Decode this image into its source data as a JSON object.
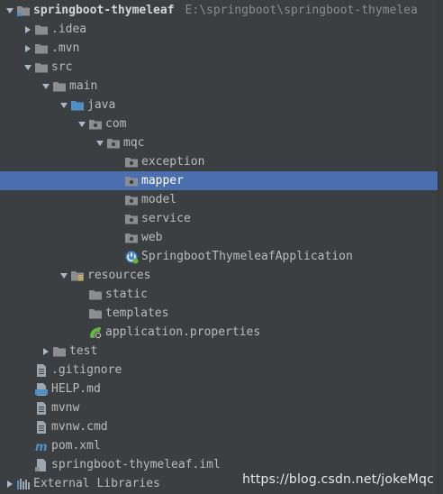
{
  "project": {
    "name": "springboot-thymeleaf",
    "path": "E:\\springboot\\springboot-thymelea"
  },
  "tree": [
    {
      "label": "springboot-thymeleaf",
      "icon": "project-folder-icon",
      "expanded": true,
      "depth": 0
    },
    {
      "label": ".idea",
      "icon": "folder-icon",
      "expanded": false,
      "depth": 1
    },
    {
      "label": ".mvn",
      "icon": "folder-icon",
      "expanded": false,
      "depth": 1
    },
    {
      "label": "src",
      "icon": "folder-icon",
      "expanded": true,
      "depth": 1
    },
    {
      "label": "main",
      "icon": "folder-icon",
      "expanded": true,
      "depth": 2
    },
    {
      "label": "java",
      "icon": "source-folder-icon",
      "expanded": true,
      "depth": 3
    },
    {
      "label": "com",
      "icon": "package-icon",
      "expanded": true,
      "depth": 4
    },
    {
      "label": "mqc",
      "icon": "package-icon",
      "expanded": true,
      "depth": 5
    },
    {
      "label": "exception",
      "icon": "package-icon",
      "depth": 6
    },
    {
      "label": "mapper",
      "icon": "package-icon",
      "depth": 6,
      "selected": true
    },
    {
      "label": "model",
      "icon": "package-icon",
      "depth": 6
    },
    {
      "label": "service",
      "icon": "package-icon",
      "depth": 6
    },
    {
      "label": "web",
      "icon": "package-icon",
      "depth": 6
    },
    {
      "label": "SpringbootThymeleafApplication",
      "icon": "spring-boot-class-icon",
      "depth": 6
    },
    {
      "label": "resources",
      "icon": "resources-folder-icon",
      "expanded": true,
      "depth": 3
    },
    {
      "label": "static",
      "icon": "folder-icon",
      "depth": 4
    },
    {
      "label": "templates",
      "icon": "folder-icon",
      "depth": 4
    },
    {
      "label": "application.properties",
      "icon": "spring-properties-icon",
      "depth": 4
    },
    {
      "label": "test",
      "icon": "folder-icon",
      "expanded": false,
      "depth": 2
    },
    {
      "label": ".gitignore",
      "icon": "text-file-icon",
      "depth": 1
    },
    {
      "label": "HELP.md",
      "icon": "markdown-file-icon",
      "depth": 1
    },
    {
      "label": "mvnw",
      "icon": "text-file-icon",
      "depth": 1
    },
    {
      "label": "mvnw.cmd",
      "icon": "text-file-icon",
      "depth": 1
    },
    {
      "label": "pom.xml",
      "icon": "maven-icon",
      "depth": 1
    },
    {
      "label": "springboot-thymeleaf.iml",
      "icon": "module-file-icon",
      "depth": 1
    },
    {
      "label": "External Libraries",
      "icon": "libraries-icon",
      "expanded": false,
      "depth": 0
    }
  ],
  "watermark": "https://blog.csdn.net/jokeMqc",
  "colors": {
    "background": "#3c3f41",
    "selection": "#4b6eaf",
    "folder": "#8b8d90",
    "source_folder": "#4e8fc5",
    "spring_green": "#62b543"
  }
}
